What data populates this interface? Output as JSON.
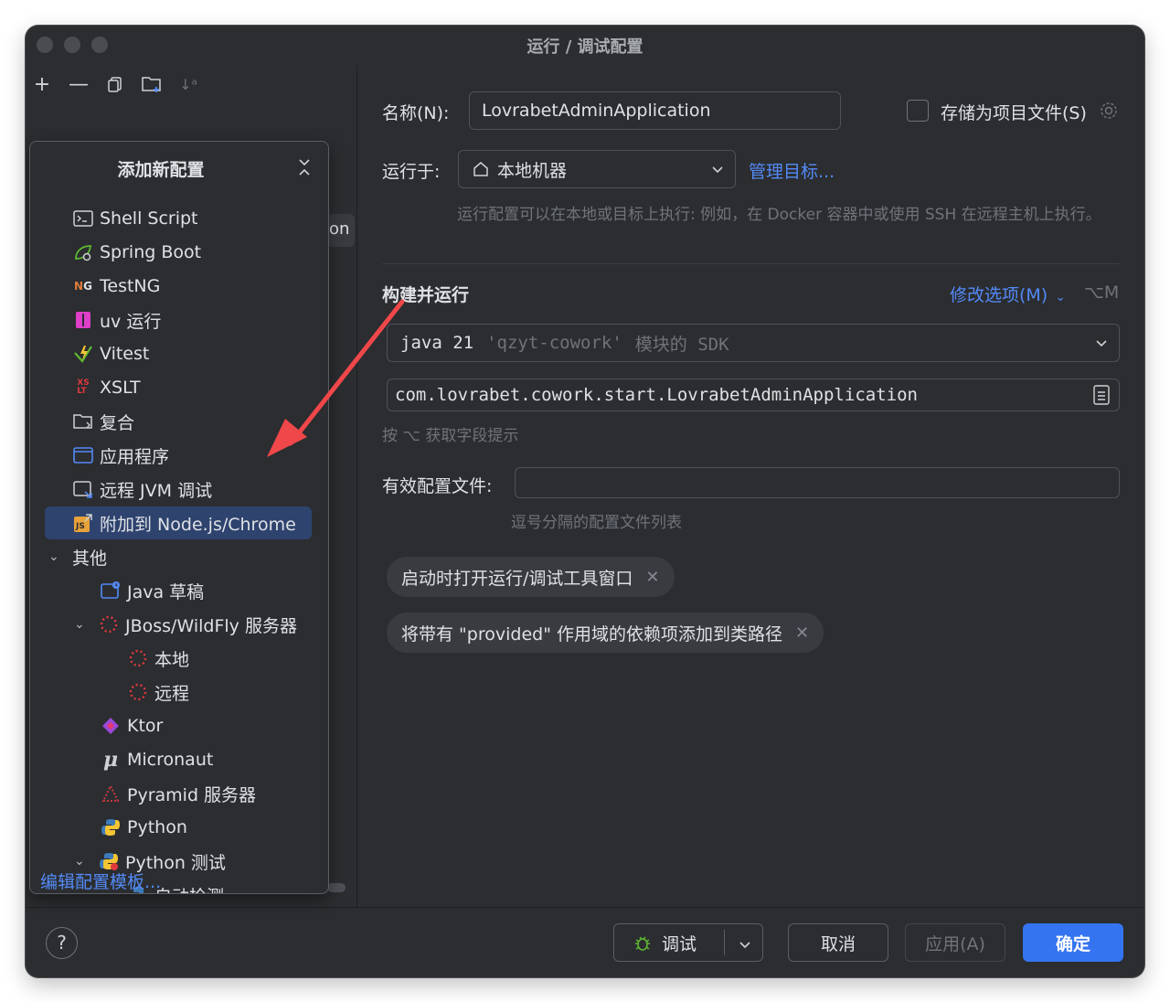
{
  "window": {
    "title": "运行 / 调试配置"
  },
  "popup": {
    "title": "添加新配置",
    "items": [
      {
        "label": "Shell Script",
        "icon": "shell-icon"
      },
      {
        "label": "Spring Boot",
        "icon": "spring-icon"
      },
      {
        "label": "TestNG",
        "icon": "testng-icon"
      },
      {
        "label": "uv 运行",
        "icon": "uv-icon"
      },
      {
        "label": "Vitest",
        "icon": "vitest-icon"
      },
      {
        "label": "XSLT",
        "icon": "xslt-icon"
      },
      {
        "label": "复合",
        "icon": "folder-icon"
      },
      {
        "label": "应用程序",
        "icon": "application-icon"
      },
      {
        "label": "远程 JVM 调试",
        "icon": "remote-debug-icon"
      },
      {
        "label": "附加到 Node.js/Chrome",
        "icon": "nodejs-icon",
        "selected": true
      },
      {
        "label": "其他",
        "icon": "chevron-down-icon",
        "group": true
      },
      {
        "label": "Java 草稿",
        "icon": "java-scratch-icon"
      },
      {
        "label": "JBoss/WildFly 服务器",
        "icon": "jboss-icon",
        "group": true
      },
      {
        "label": "本地",
        "icon": "jboss-icon"
      },
      {
        "label": "远程",
        "icon": "jboss-icon"
      },
      {
        "label": "Ktor",
        "icon": "ktor-icon"
      },
      {
        "label": "Micronaut",
        "icon": "micronaut-icon"
      },
      {
        "label": "Pyramid 服务器",
        "icon": "pyramid-icon"
      },
      {
        "label": "Python",
        "icon": "python-icon"
      },
      {
        "label": "Python 测试",
        "icon": "python-icon",
        "group": true
      },
      {
        "label": "自动检测",
        "icon": "python-icon"
      }
    ],
    "edit_templates": "编辑配置模板..."
  },
  "behind_text": "on",
  "form": {
    "name_label": "名称(N):",
    "name_value": "LovrabetAdminApplication",
    "store_as_file": "存储为项目文件(S)",
    "run_on_label": "运行于:",
    "run_on_value": "本地机器",
    "manage_targets": "管理目标...",
    "run_on_hint": "运行配置可以在本地或目标上执行: 例如，在 Docker 容器中或使用 SSH 在远程主机上执行。",
    "section_title": "构建并运行",
    "modify_options": "修改选项(M)",
    "modify_shortcut": "⌥M",
    "sdk_java": "java 21",
    "sdk_module": "'qzyt-cowork'",
    "sdk_suffix": "模块的 SDK",
    "main_class": "com.lovrabet.cowork.start.LovrabetAdminApplication",
    "field_hint": "按 ⌥ 获取字段提示",
    "profiles_label": "有效配置文件:",
    "profiles_value": "",
    "profiles_hint": "逗号分隔的配置文件列表",
    "tags": [
      "启动时打开运行/调试工具窗口",
      "将带有 \"provided\" 作用域的依赖项添加到类路径"
    ]
  },
  "footer": {
    "help": "?",
    "debug": "调试",
    "cancel": "取消",
    "apply": "应用(A)",
    "ok": "确定"
  },
  "colors": {
    "background": "#2b2d30",
    "accent": "#3574f0",
    "link": "#548af7",
    "selection": "#2e436e",
    "annotation_arrow": "#f0474a"
  }
}
